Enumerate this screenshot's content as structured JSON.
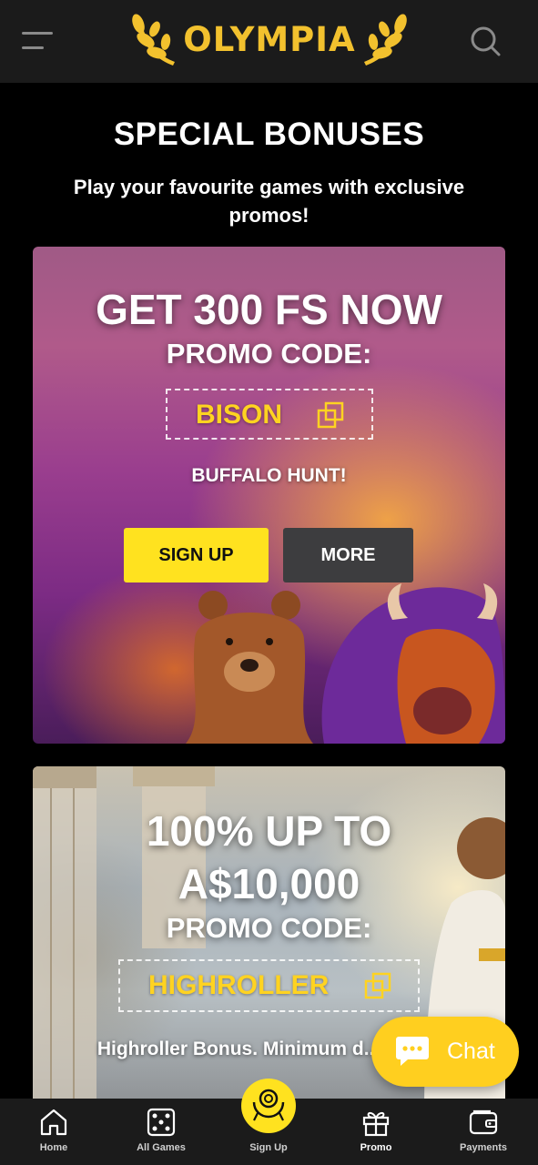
{
  "header": {
    "logo_text": "OLYMPIA",
    "menu_icon": "hamburger-menu-icon",
    "search_icon": "search-icon"
  },
  "hero": {
    "title": "SPECIAL BONUSES",
    "subtitle": "Play your favourite games with exclusive promos!"
  },
  "promos": [
    {
      "headline": "GET 300 FS NOW",
      "promo_label": "PROMO CODE:",
      "code": "BISON",
      "subtitle": "BUFFALO HUNT!",
      "signup_label": "SIGN UP",
      "more_label": "MORE"
    },
    {
      "headline_line1": "100% UP TO",
      "headline_line2": "A$10,000",
      "promo_label": "PROMO CODE:",
      "code": "HIGHROLLER",
      "description": "Highroller Bonus. Minimum d... A$125"
    }
  ],
  "chat": {
    "label": "Chat",
    "icon": "chat-bubble-icon"
  },
  "bottom_nav": {
    "items": [
      {
        "label": "Home",
        "icon": "home-icon"
      },
      {
        "label": "All Games",
        "icon": "dice-icon"
      },
      {
        "label": "Sign Up",
        "icon": "laurel-icon"
      },
      {
        "label": "Promo",
        "icon": "gift-icon",
        "active": true
      },
      {
        "label": "Payments",
        "icon": "wallet-icon"
      }
    ]
  },
  "colors": {
    "accent_yellow": "#ffe21f",
    "logo_gold": "#f2c12e",
    "code_yellow": "#ffd321",
    "header_bg": "#1b1b1b",
    "more_button_bg": "#3d3d3f"
  }
}
